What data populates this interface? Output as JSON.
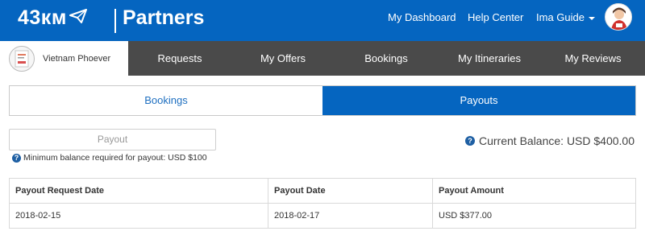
{
  "header": {
    "logo_text": "43км",
    "brand": "Partners",
    "nav": {
      "dashboard": "My Dashboard",
      "help": "Help Center",
      "user": "Ima Guide"
    },
    "colors": {
      "primary": "#0565c0",
      "subnav_bg": "#4a4a4a"
    }
  },
  "subnav": {
    "account_name": "Vietnam Phoever",
    "items": [
      {
        "label": "Requests"
      },
      {
        "label": "My Offers"
      },
      {
        "label": "Bookings"
      },
      {
        "label": "My Itineraries"
      },
      {
        "label": "My Reviews"
      }
    ]
  },
  "tabs": [
    {
      "label": "Bookings",
      "active": false
    },
    {
      "label": "Payouts",
      "active": true
    }
  ],
  "payout": {
    "button_label": "Payout",
    "min_note": "Minimum balance required for payout: USD $100",
    "balance": "Current Balance: USD $400.00"
  },
  "table": {
    "headers": [
      "Payout Request Date",
      "Payout Date",
      "Payout Amount"
    ],
    "rows": [
      [
        "2018-02-15",
        "2018-02-17",
        "USD $377.00"
      ]
    ]
  }
}
